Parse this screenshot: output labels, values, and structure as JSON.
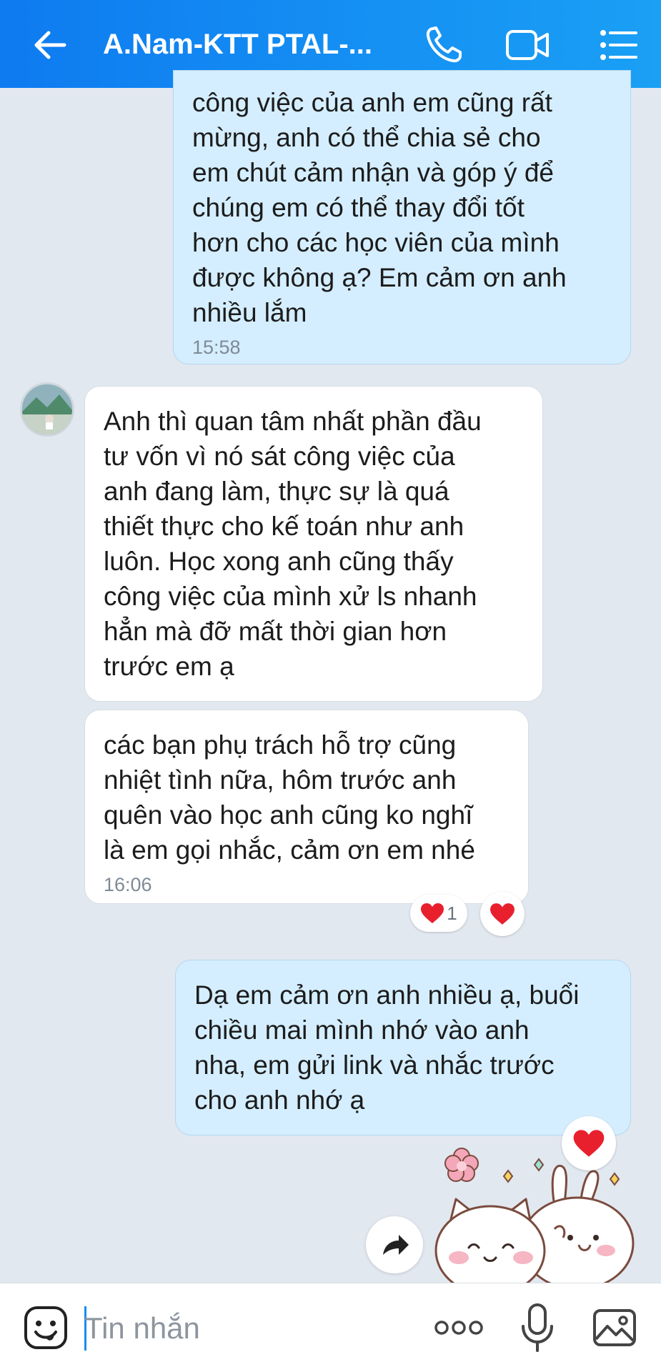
{
  "header": {
    "title": "A.Nam-KTT PTAL-...",
    "icons": [
      "back-arrow-icon",
      "phone-icon",
      "video-call-icon",
      "menu-list-icon"
    ]
  },
  "messages": [
    {
      "direction": "outgoing",
      "text": "công việc của anh em cũng rất\nmừng, anh có thể chia sẻ cho\nem chút cảm nhận và góp ý để\nchúng em có thể thay đổi tốt\nhơn cho các học viên của mình\nđược không ạ? Em cảm ơn anh\nnhiều lắm",
      "time": "15:58"
    },
    {
      "direction": "incoming",
      "text": "Anh thì quan tâm nhất phần đầu\ntư vốn vì nó sát công việc của\nanh đang làm, thực sự là quá\nthiết thực cho kế toán như anh\nluôn. Học xong anh cũng thấy\ncông việc của mình xử ls nhanh\nhẳn mà đỡ mất thời gian hơn\ntrước em ạ"
    },
    {
      "direction": "incoming",
      "text": "các bạn phụ trách hỗ trợ cũng\nnhiệt tình nữa, hôm trước anh\nquên vào học anh cũng ko nghĩ\nlà em gọi nhắc, cảm ơn em nhé",
      "time": "16:06",
      "reaction_count": "1"
    },
    {
      "direction": "outgoing",
      "text": "Dạ em cảm ơn anh nhiều ạ, buổi\nchiều mai mình nhớ vào anh\nnha, em gửi link và nhắc trước\ncho anh nhớ ạ"
    }
  ],
  "input": {
    "placeholder": "Tin nhắn",
    "icons": [
      "sticker-smiley-icon",
      "more-dots-icon",
      "microphone-icon",
      "image-gallery-icon"
    ]
  },
  "colors": {
    "header_start": "#0e7bf0",
    "header_end": "#1aa0f5",
    "outgoing_bubble": "#d4eeff",
    "incoming_bubble": "#ffffff",
    "background": "#e2e8ef",
    "heart": "#e8202e"
  }
}
